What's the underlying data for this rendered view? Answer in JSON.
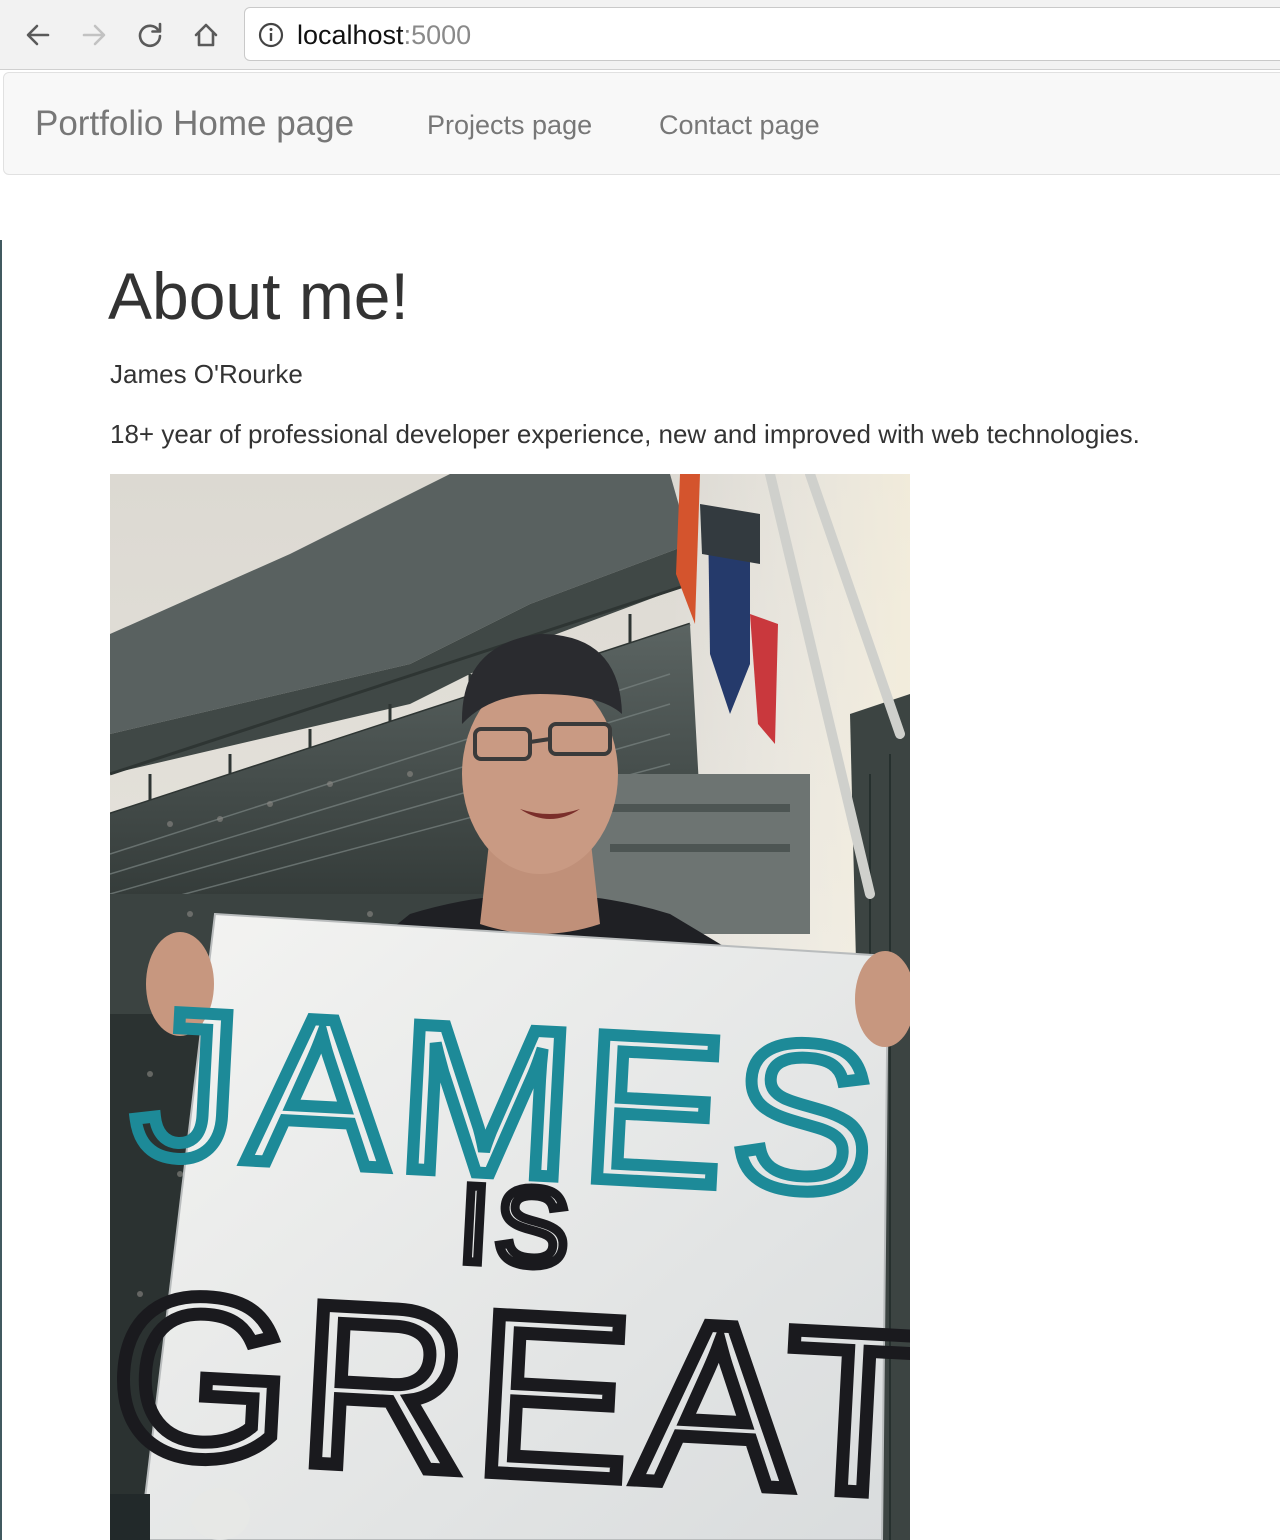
{
  "browser": {
    "url_host": "localhost",
    "url_port": ":5000",
    "icons": {
      "back": "arrow-left-icon",
      "forward": "arrow-right-icon",
      "reload": "reload-icon",
      "home": "home-icon",
      "site_info": "info-circle-icon"
    }
  },
  "navbar": {
    "brand": "Portfolio Home page",
    "links": [
      "Projects page",
      "Contact page"
    ]
  },
  "main": {
    "heading": "About me!",
    "name": "James O'Rourke",
    "bio": "18+ year of professional developer experience, new and improved with web technologies."
  },
  "photo": {
    "sign_line1": "JAMES",
    "sign_line2": "IS",
    "sign_line3": "GREAT",
    "colors": {
      "sign_teal": "#1d8a98",
      "sign_black": "#1a1a1e",
      "sky": "#e9e6df",
      "stadium": "#4a5250"
    }
  }
}
